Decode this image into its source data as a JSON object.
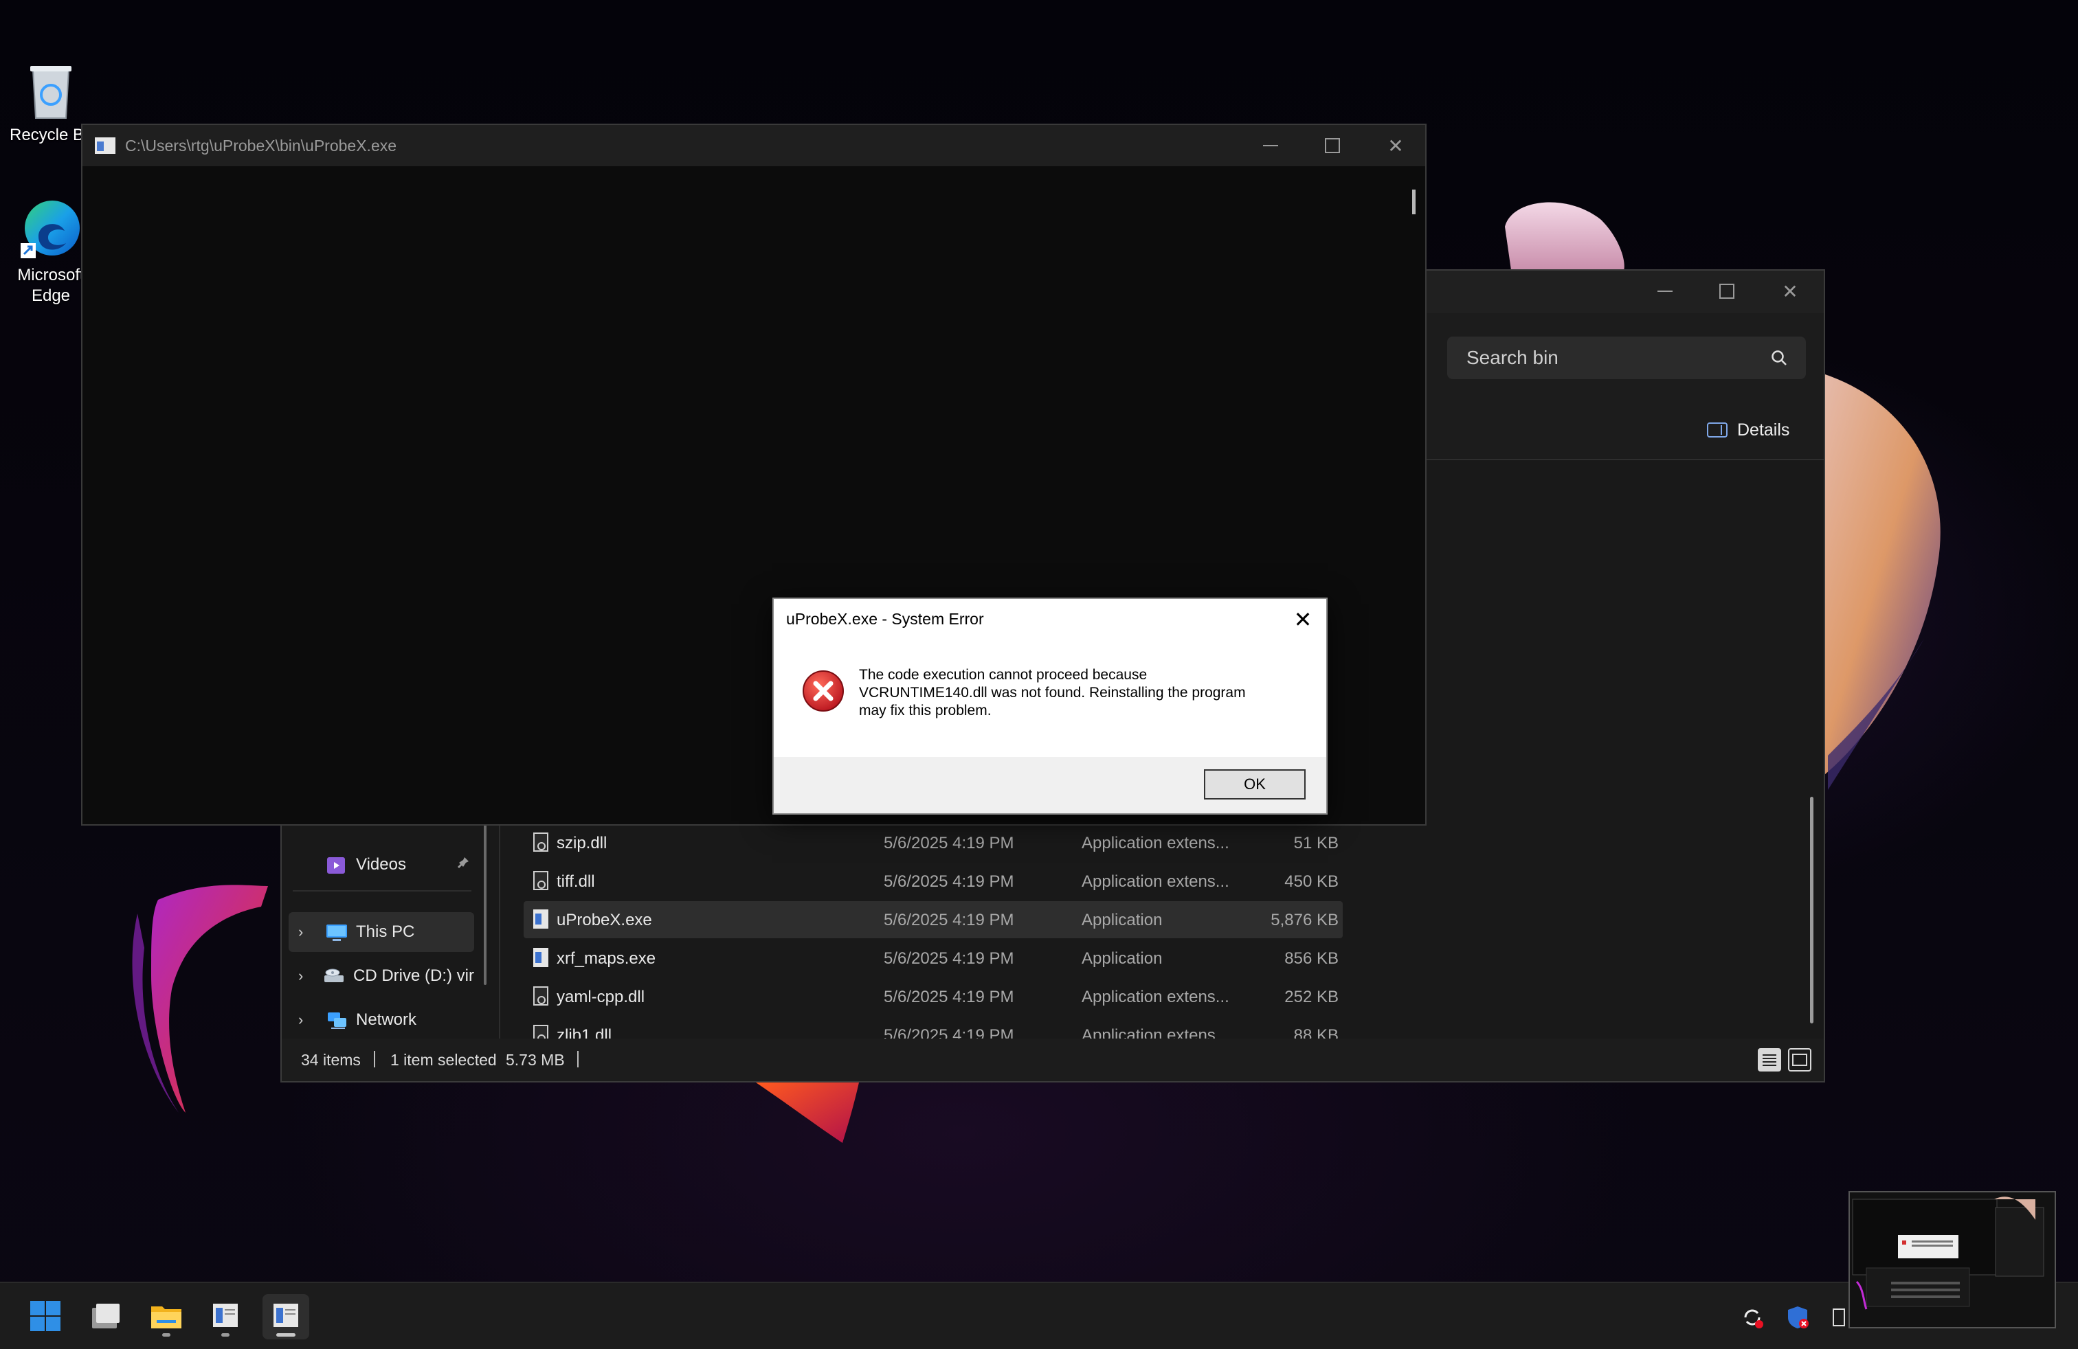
{
  "desktop": {
    "icons": [
      {
        "label": "Recycle Bi"
      },
      {
        "label": "Microsoft Edge"
      }
    ]
  },
  "console": {
    "title": "C:\\Users\\rtg\\uProbeX\\bin\\uProbeX.exe"
  },
  "explorer": {
    "search_placeholder": "Search bin",
    "details_label": "Details",
    "nav": {
      "items": [
        {
          "label": "Videos"
        },
        {
          "label": "This PC"
        },
        {
          "label": "CD Drive (D:) vir"
        },
        {
          "label": "Network"
        }
      ]
    },
    "files": [
      {
        "name": "szip.dll",
        "date": "5/6/2025 4:19 PM",
        "type": "Application extens...",
        "size": "51 KB"
      },
      {
        "name": "tiff.dll",
        "date": "5/6/2025 4:19 PM",
        "type": "Application extens...",
        "size": "450 KB"
      },
      {
        "name": "uProbeX.exe",
        "date": "5/6/2025 4:19 PM",
        "type": "Application",
        "size": "5,876 KB"
      },
      {
        "name": "xrf_maps.exe",
        "date": "5/6/2025 4:19 PM",
        "type": "Application",
        "size": "856 KB"
      },
      {
        "name": "yaml-cpp.dll",
        "date": "5/6/2025 4:19 PM",
        "type": "Application extens...",
        "size": "252 KB"
      },
      {
        "name": "zlib1.dll",
        "date": "5/6/2025 4:19 PM",
        "type": "Application extens...",
        "size": "88 KB"
      }
    ],
    "status": {
      "items_count": "34 items",
      "selected": "1 item selected",
      "selected_size": "5.73 MB"
    }
  },
  "dialog": {
    "title": "uProbeX.exe - System Error",
    "message_lines": [
      "The code execution cannot proceed because",
      "VCRUNTIME140.dll was not found. Reinstalling the program",
      "may fix this problem."
    ],
    "ok_label": "OK"
  },
  "colors": {
    "dialog_error": "#d32f2f",
    "taskbar": "#1c1c1c",
    "windows_blue": "#2f8fe6"
  }
}
